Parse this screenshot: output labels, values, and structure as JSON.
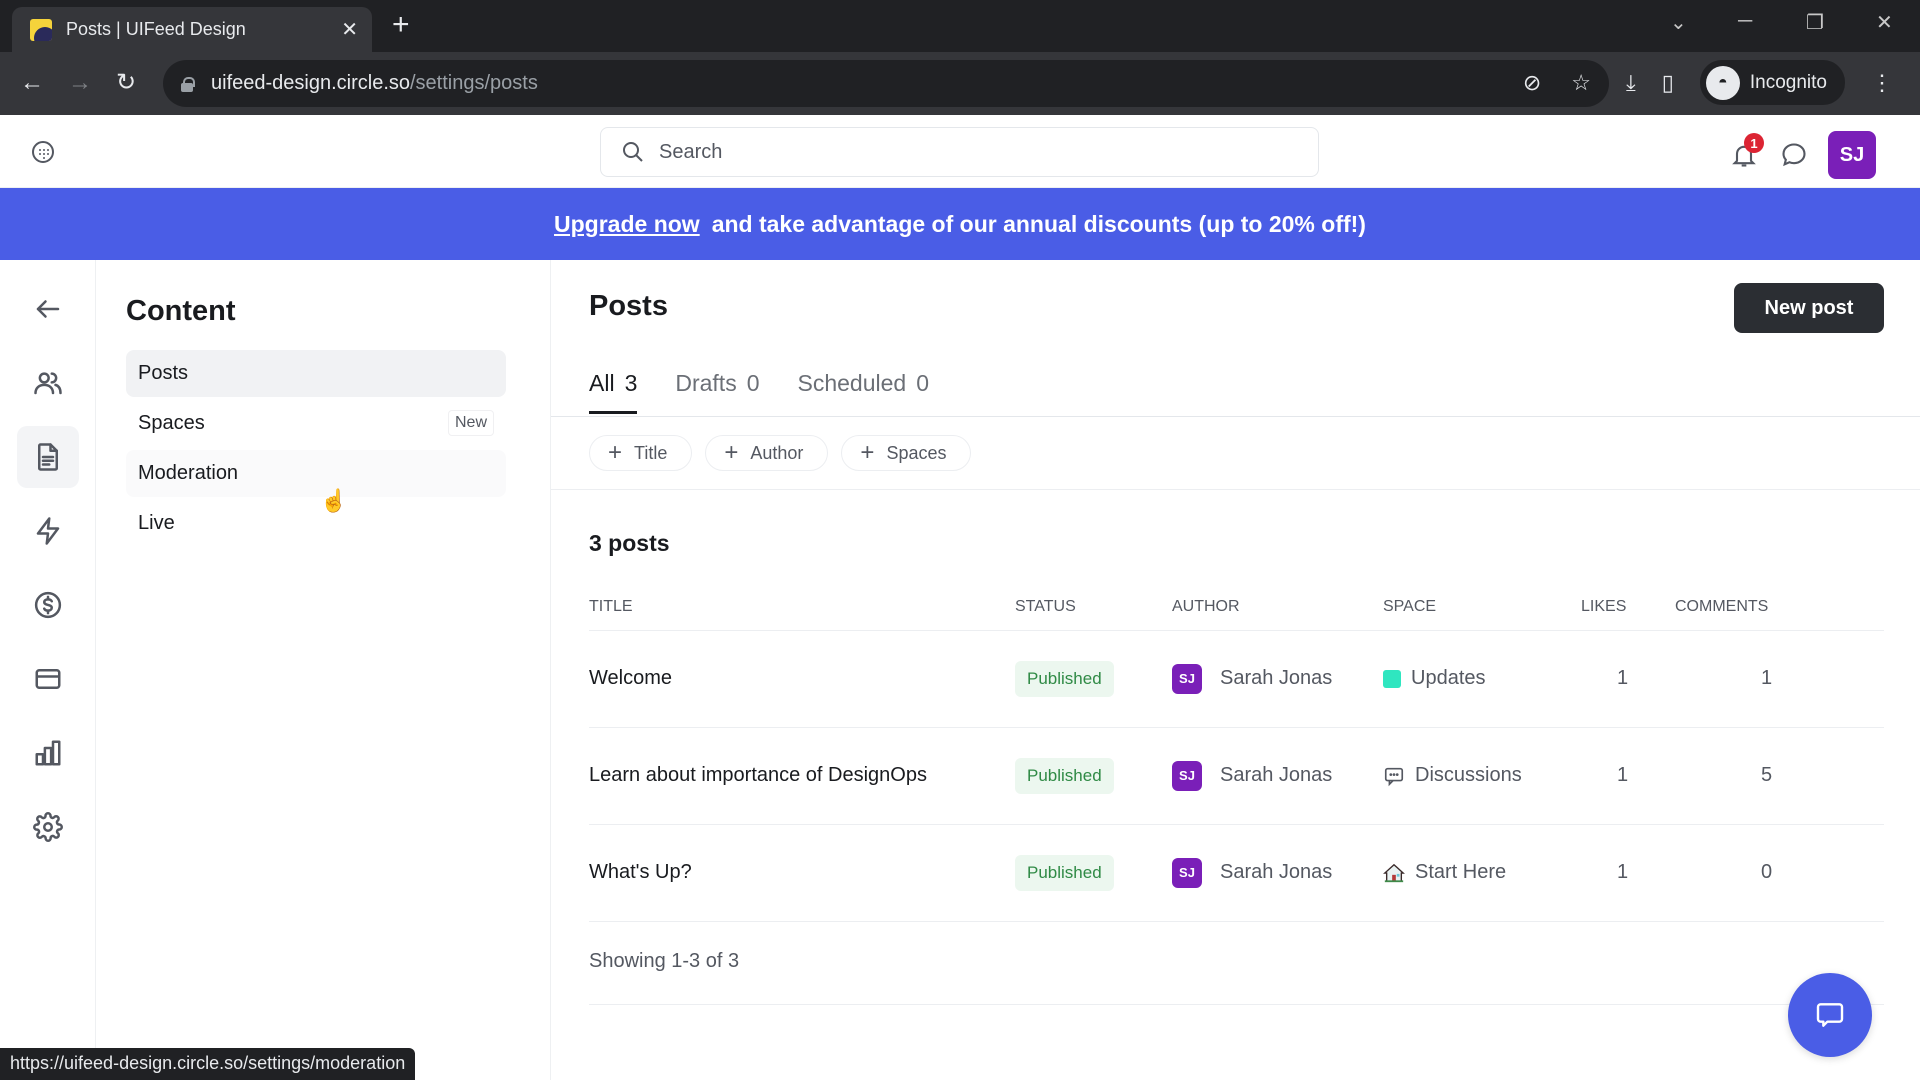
{
  "browser": {
    "tab_title": "Posts | UIFeed Design",
    "url_host": "uifeed-design.circle.so",
    "url_path": "/settings/posts",
    "profile_label": "Incognito",
    "status_url": "https://uifeed-design.circle.so/settings/moderation"
  },
  "header": {
    "search_placeholder": "Search",
    "notification_count": "1",
    "user_initials": "SJ"
  },
  "banner": {
    "link_text": "Upgrade now",
    "message": "and take advantage of our annual discounts (up to 20% off!)",
    "color": "#4a5de6"
  },
  "rail": {
    "items": [
      "back-arrow-icon",
      "members-icon",
      "content-icon",
      "workflows-icon",
      "paywalls-icon",
      "billing-icon",
      "analytics-icon",
      "settings-icon"
    ],
    "active": "content-icon"
  },
  "subnav": {
    "title": "Content",
    "items": [
      {
        "label": "Posts",
        "state": "active"
      },
      {
        "label": "Spaces",
        "tag": "New"
      },
      {
        "label": "Moderation",
        "state": "hover"
      },
      {
        "label": "Live"
      }
    ]
  },
  "main": {
    "title": "Posts",
    "new_post_label": "New post",
    "tabs": [
      {
        "label": "All",
        "count": "3",
        "active": true
      },
      {
        "label": "Drafts",
        "count": "0"
      },
      {
        "label": "Scheduled",
        "count": "0"
      }
    ],
    "filters": [
      "Title",
      "Author",
      "Spaces"
    ],
    "count_label": "3 posts",
    "columns": [
      "TITLE",
      "STATUS",
      "AUTHOR",
      "SPACE",
      "LIKES",
      "COMMENTS"
    ],
    "rows": [
      {
        "title": "Welcome",
        "status": "Published",
        "author_initials": "SJ",
        "author": "Sarah Jonas",
        "space_icon": "color-square",
        "space": "Updates",
        "likes": "1",
        "comments": "1"
      },
      {
        "title": "Learn about importance of DesignOps",
        "status": "Published",
        "author_initials": "SJ",
        "author": "Sarah Jonas",
        "space_icon": "chat-bubble-icon",
        "space": "Discussions",
        "likes": "1",
        "comments": "5"
      },
      {
        "title": "What's Up?",
        "status": "Published",
        "author_initials": "SJ",
        "author": "Sarah Jonas",
        "space_icon": "house-emoji",
        "space": "Start Here",
        "likes": "1",
        "comments": "0"
      }
    ],
    "showing": "Showing 1-3 of 3"
  },
  "colors": {
    "accent": "#4a5de6",
    "avatar": "#7a1fb8",
    "published_text": "#2f8a45",
    "published_bg": "#ecf7ef",
    "updates_space": "#2fe6c0"
  }
}
